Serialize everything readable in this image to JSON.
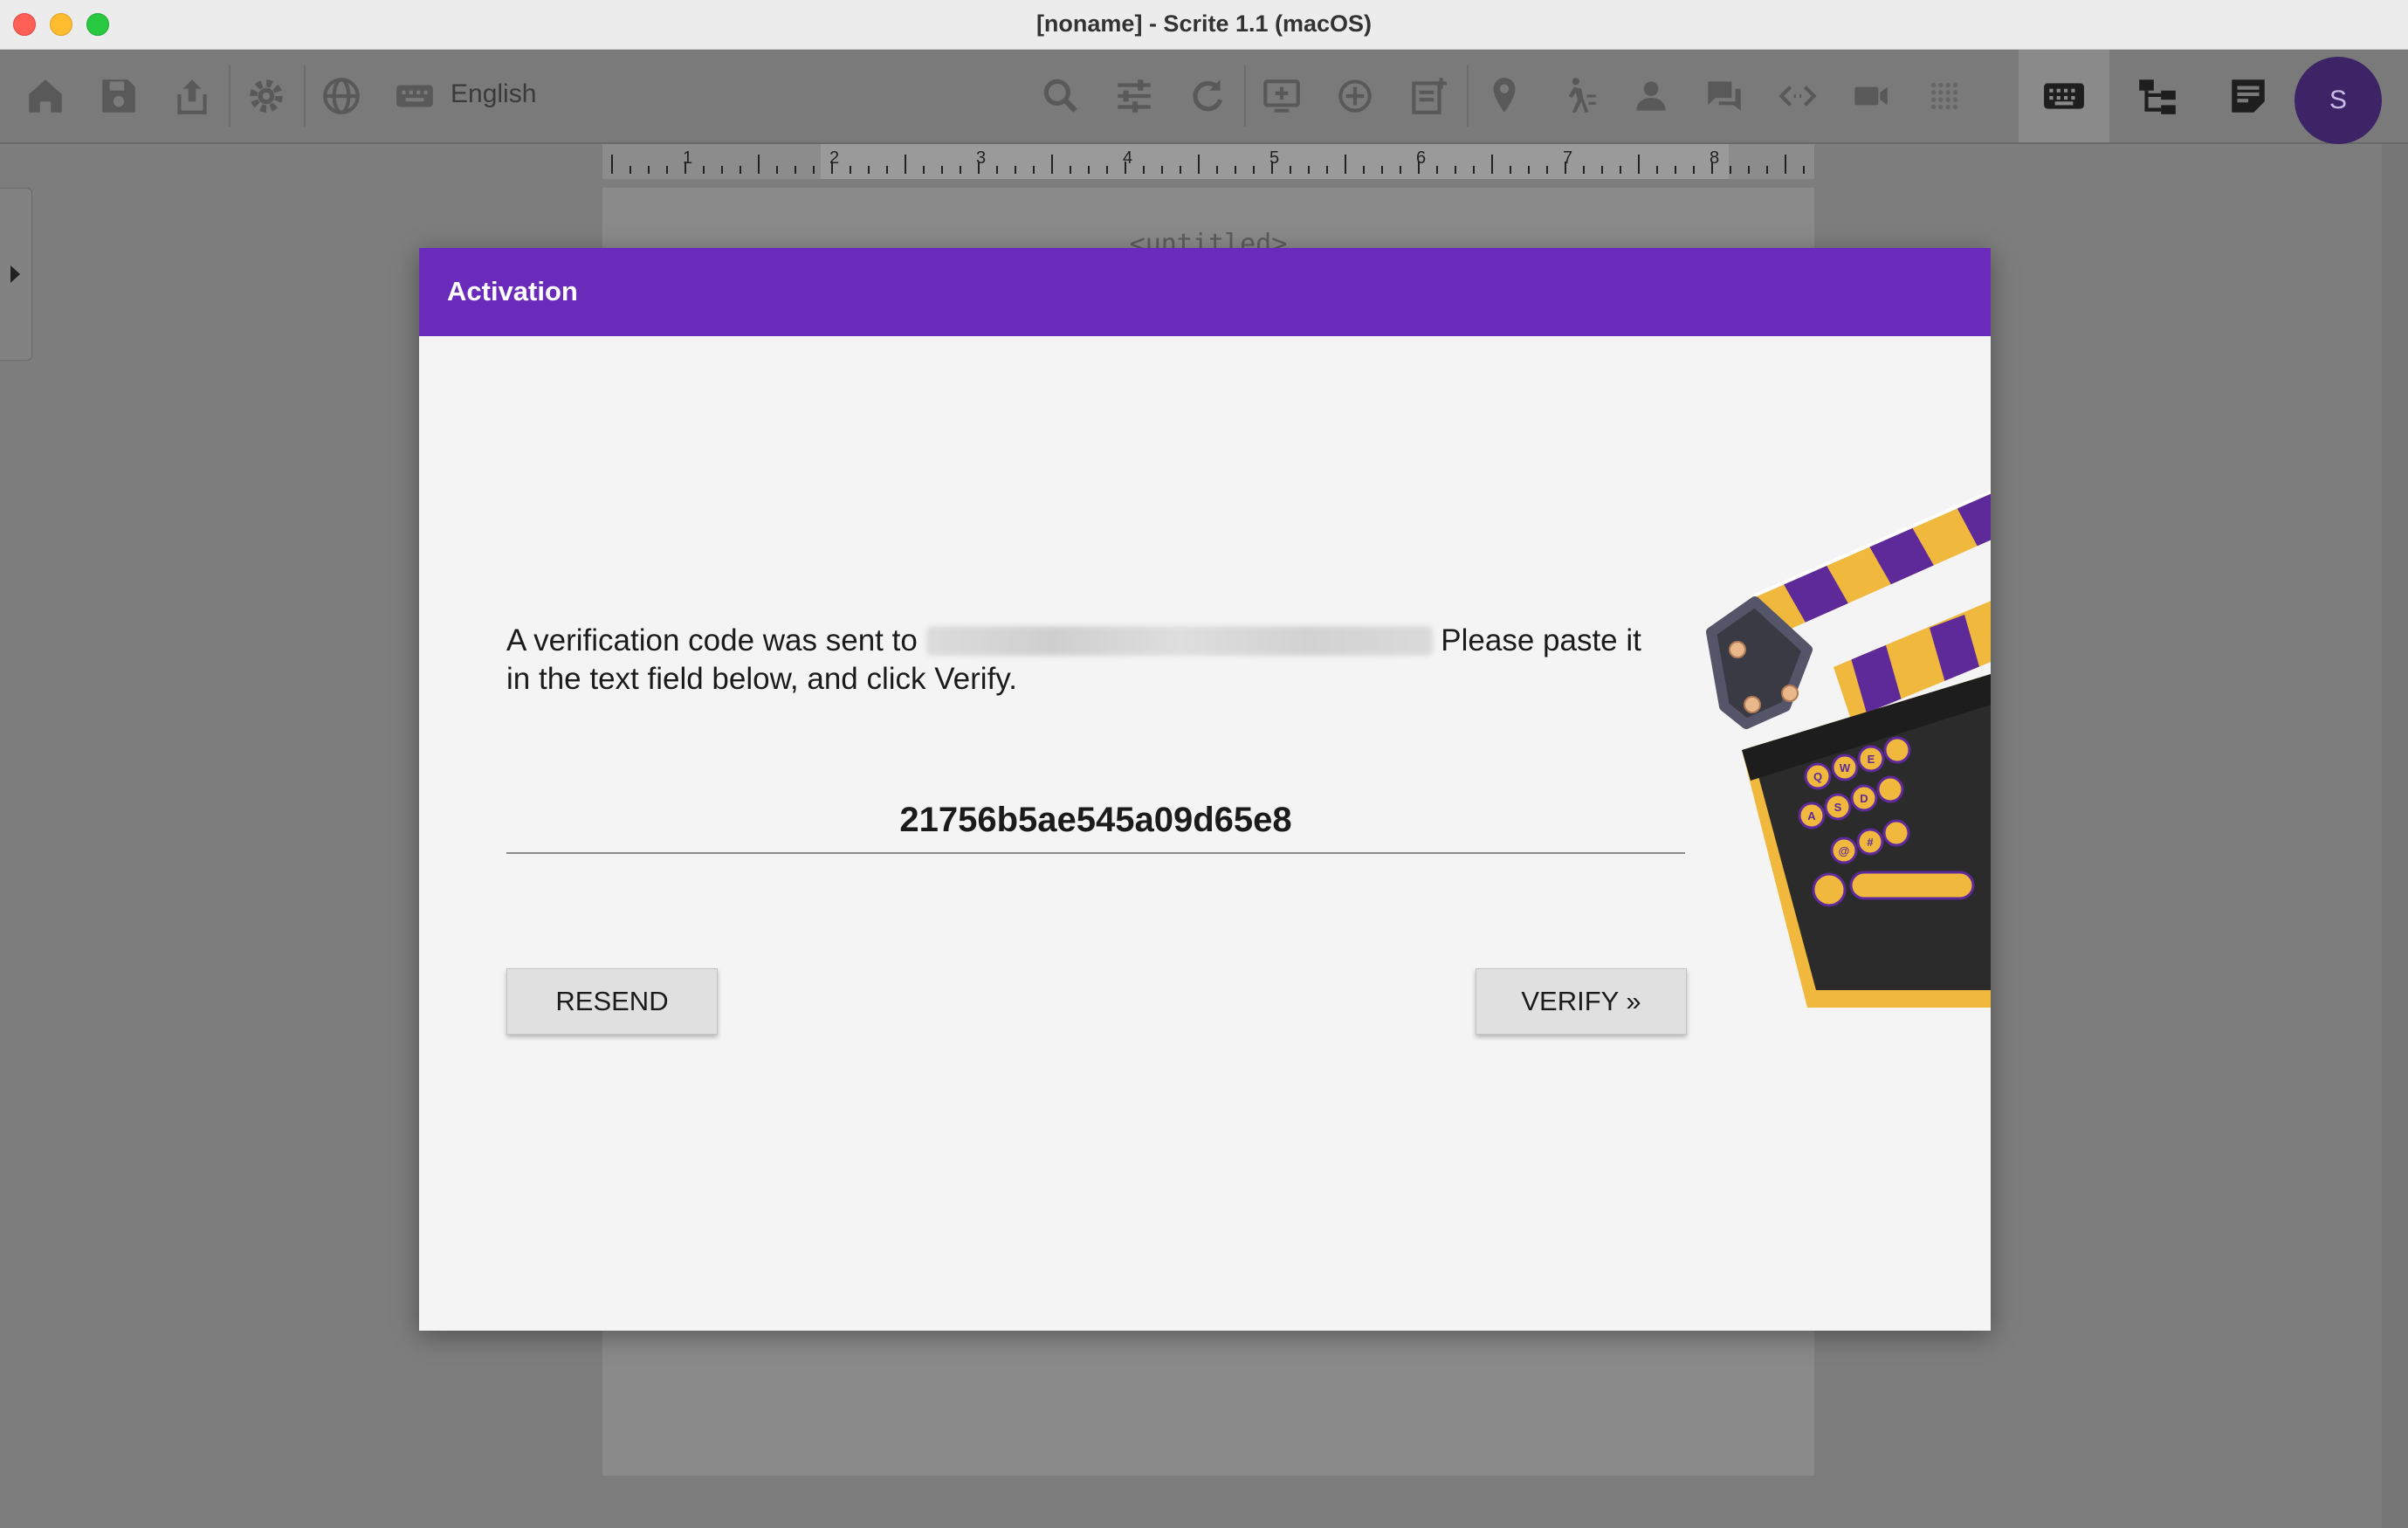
{
  "window": {
    "title": "[noname] - Scrite 1.1 (macOS)"
  },
  "toolbar": {
    "language_label": "English",
    "avatar_initial": "S",
    "icons": [
      "home-icon",
      "save-icon",
      "share-icon",
      "settings-icon",
      "globe-icon",
      "keyboard-icon",
      "search-icon",
      "sliders-icon",
      "refresh-icon",
      "add-scene-icon",
      "add-target-icon",
      "add-note-icon",
      "location-icon",
      "action-icon",
      "character-icon",
      "dialogue-icon",
      "transition-icon",
      "shot-icon",
      "grid-icon",
      "keyboard-view-icon",
      "structure-icon",
      "notebook-icon"
    ]
  },
  "ruler": {
    "numbers": [
      "1",
      "2",
      "3",
      "4",
      "5",
      "6",
      "7",
      "8"
    ]
  },
  "document": {
    "title": "<untitled>"
  },
  "dialog": {
    "title": "Activation",
    "message_before": "A verification code was sent to ",
    "message_after": " Please paste it in the text field below, and click Verify.",
    "code_value": "21756b5ae545a09d65e8",
    "resend_label": "RESEND",
    "verify_label": "VERIFY »"
  },
  "colors": {
    "accent": "#6a2bbb",
    "clapper_yellow": "#f0b83c",
    "clapper_dark": "#2b2b2b"
  }
}
